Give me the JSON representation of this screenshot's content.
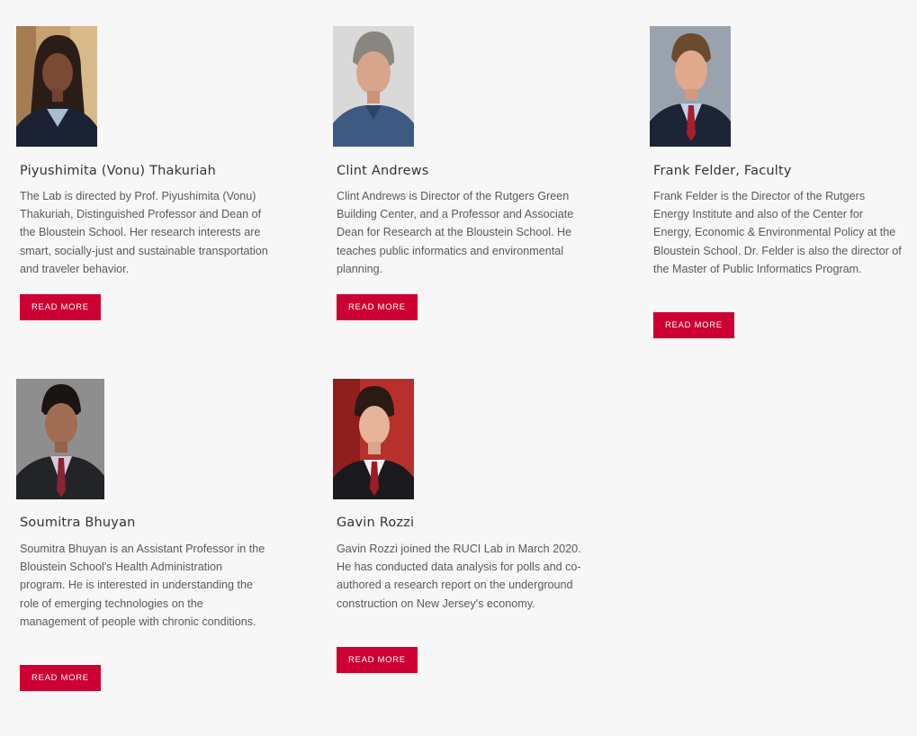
{
  "people": [
    {
      "name": "Piyushimita (Vonu) Thakuriah",
      "bio": "The Lab is directed by Prof. Piyushimita (Vonu) Thakuriah, Distinguished Professor and Dean of the Bloustein School. Her research interests are smart, socially-just and sustainable transportation and traveler behavior.",
      "button": "READ MORE"
    },
    {
      "name": "Clint Andrews",
      "bio": "Clint Andrews is Director of the Rutgers Green Building Center, and a Professor and Associate Dean for Research at the Bloustein School. He teaches public informatics and environmental planning.",
      "button": "READ MORE"
    },
    {
      "name": "Frank Felder, Faculty",
      "bio": "Frank Felder is the Director of the Rutgers Energy Institute and also of the Center for Energy, Economic & Environmental Policy at the Bloustein School. Dr. Felder is also the director of the Master of Public Informatics Program.",
      "button": "READ MORE"
    },
    {
      "name": "Soumitra Bhuyan",
      "bio": "Soumitra Bhuyan is an Assistant Professor in the Bloustein School's Health Administration program. He is interested in understanding the role of emerging technologies on the management of people with chronic conditions.",
      "button": "READ MORE"
    },
    {
      "name": "Gavin Rozzi",
      "bio": "Gavin Rozzi joined the RUCI Lab in March 2020. He has conducted data analysis for polls and co-authored a research report on the underground construction on New Jersey's economy.",
      "button": "READ MORE"
    }
  ],
  "colors": {
    "accent": "#cc0033",
    "background": "#f7f7f7"
  }
}
